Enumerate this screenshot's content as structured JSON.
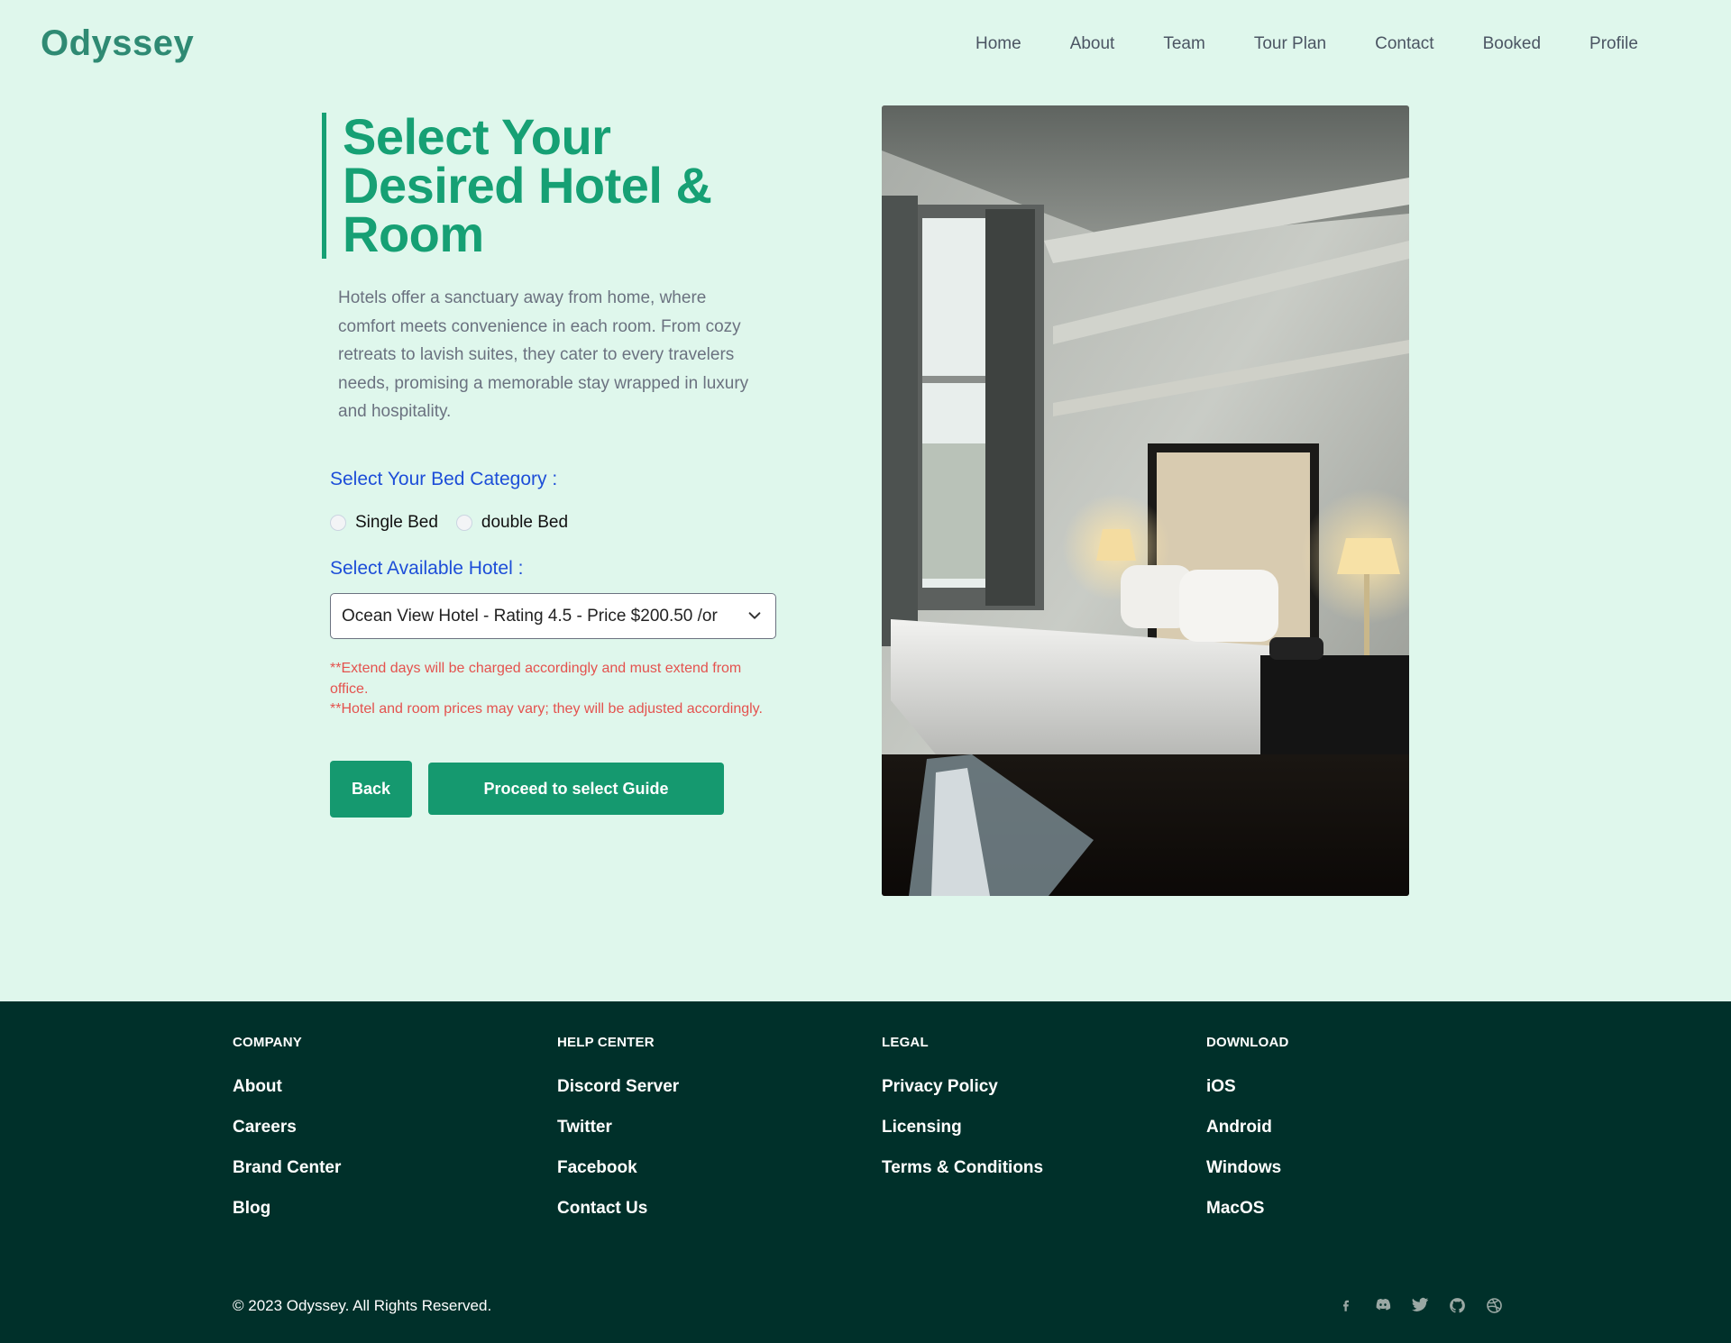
{
  "brand": "Odyssey",
  "nav": [
    "Home",
    "About",
    "Team",
    "Tour Plan",
    "Contact",
    "Booked",
    "Profile"
  ],
  "hero": {
    "title": "Select Your Desired Hotel & Room",
    "description": "Hotels offer a sanctuary away from home, where comfort meets convenience in each room. From cozy retreats to lavish suites, they cater to every travelers needs, promising a memorable stay wrapped in luxury and hospitality.",
    "bed_label": "Select Your Bed Category :",
    "bed_options": [
      "Single Bed",
      "double Bed"
    ],
    "hotel_label": "Select Available Hotel :",
    "hotel_selected": "Ocean View Hotel - Rating 4.5 - Price $200.50 /or",
    "notes": [
      "**Extend days will be charged accordingly and must extend from office.",
      "**Hotel and room prices may vary; they will be adjusted accordingly."
    ],
    "back_label": "Back",
    "proceed_label": "Proceed to select Guide"
  },
  "footer": {
    "columns": [
      {
        "title": "COMPANY",
        "links": [
          "About",
          "Careers",
          "Brand Center",
          "Blog"
        ]
      },
      {
        "title": "HELP CENTER",
        "links": [
          "Discord Server",
          "Twitter",
          "Facebook",
          "Contact Us"
        ]
      },
      {
        "title": "LEGAL",
        "links": [
          "Privacy Policy",
          "Licensing",
          "Terms & Conditions"
        ]
      },
      {
        "title": "DOWNLOAD",
        "links": [
          "iOS",
          "Android",
          "Windows",
          "MacOS"
        ]
      }
    ],
    "copyright": "© 2023 Odyssey. All Rights Reserved.",
    "socials": [
      "facebook-icon",
      "discord-icon",
      "twitter-icon",
      "github-icon",
      "dribbble-icon"
    ]
  },
  "colors": {
    "background": "#dff7ec",
    "accent": "#16a074",
    "footer": "#00302a",
    "label": "#1d4ed8",
    "note": "#e4524e"
  }
}
